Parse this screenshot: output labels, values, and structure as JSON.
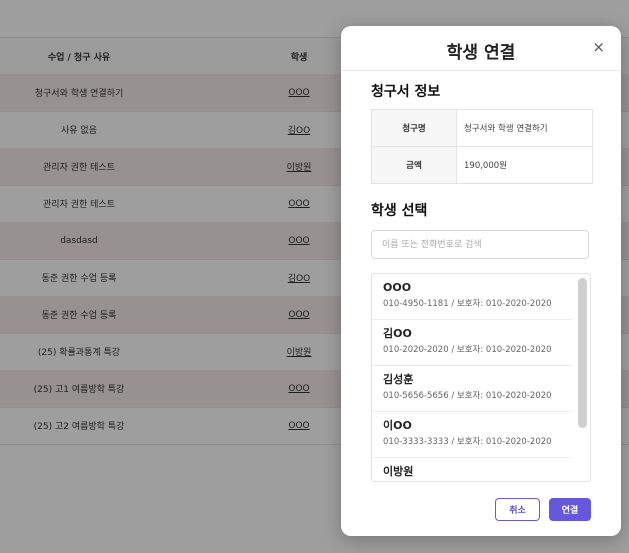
{
  "table": {
    "headers": {
      "reason": "수업 / 청구 사유",
      "student": "학생"
    },
    "rows": [
      {
        "reason": "청구서와 학생 연결하기",
        "student": "OOO"
      },
      {
        "reason": "사유 없음",
        "student": "김OO"
      },
      {
        "reason": "관리자 권한 테스트",
        "student": "이방원"
      },
      {
        "reason": "관리자 권한 테스트",
        "student": "OOO"
      },
      {
        "reason": "dasdasd",
        "student": "OOO"
      },
      {
        "reason": "동준 권한 수업 등록",
        "student": "김OO"
      },
      {
        "reason": "동준 권한 수업 등록",
        "student": "OOO"
      },
      {
        "reason": "(25) 확률과통계 특강",
        "student": "이방원"
      },
      {
        "reason": "(25) 고1 여름방학 특강",
        "student": "OOO"
      },
      {
        "reason": "(25) 고2 여름방학 특강",
        "student": "OOO"
      }
    ]
  },
  "modal": {
    "title": "학생 연결",
    "close": "×",
    "invoice_section": "청구서 정보",
    "invoice": [
      {
        "key": "청구명",
        "value": "청구서와 학생 연결하기"
      },
      {
        "key": "금액",
        "value": "190,000원"
      }
    ],
    "student_section": "학생 선택",
    "search_placeholder": "이름 또는 전화번호로 검색",
    "students": [
      {
        "name": "OOO",
        "detail": "010-4950-1181 / 보호자: 010-2020-2020"
      },
      {
        "name": "김OO",
        "detail": "010-2020-2020 / 보호자: 010-2020-2020"
      },
      {
        "name": "김성훈",
        "detail": "010-5656-5656 / 보호자: 010-2020-2020"
      },
      {
        "name": "이OO",
        "detail": "010-3333-3333 / 보호자: 010-2020-2020"
      },
      {
        "name": "이방원",
        "detail": ""
      }
    ],
    "cancel_label": "취소",
    "confirm_label": "연결"
  }
}
